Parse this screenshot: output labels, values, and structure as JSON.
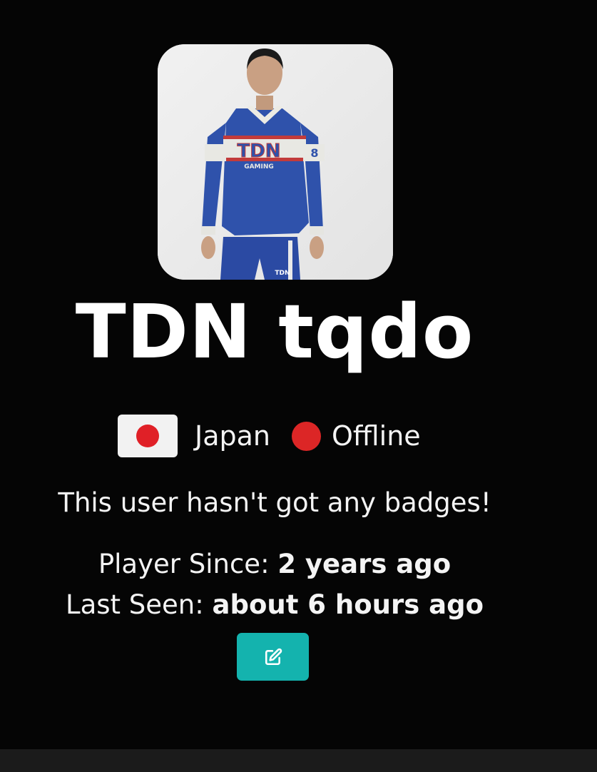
{
  "profile": {
    "username": "TDN tqdo",
    "avatar_icon": "player-photo",
    "avatar_jersey_text": "TDN",
    "avatar_jersey_subtext": "GAMING",
    "avatar_shorts_text": "TDN",
    "avatar_sleeve_number": "8",
    "country": "Japan",
    "flag_icon": "japan-flag-icon",
    "status": "Offline",
    "status_color": "#dc2626",
    "badges_text": "This user hasn't got any badges!",
    "player_since_label": "Player Since:",
    "player_since_value": "2 years ago",
    "last_seen_label": "Last Seen:",
    "last_seen_value": "about 6 hours ago",
    "edit_icon": "edit-icon",
    "accent_color": "#14b3ae"
  }
}
